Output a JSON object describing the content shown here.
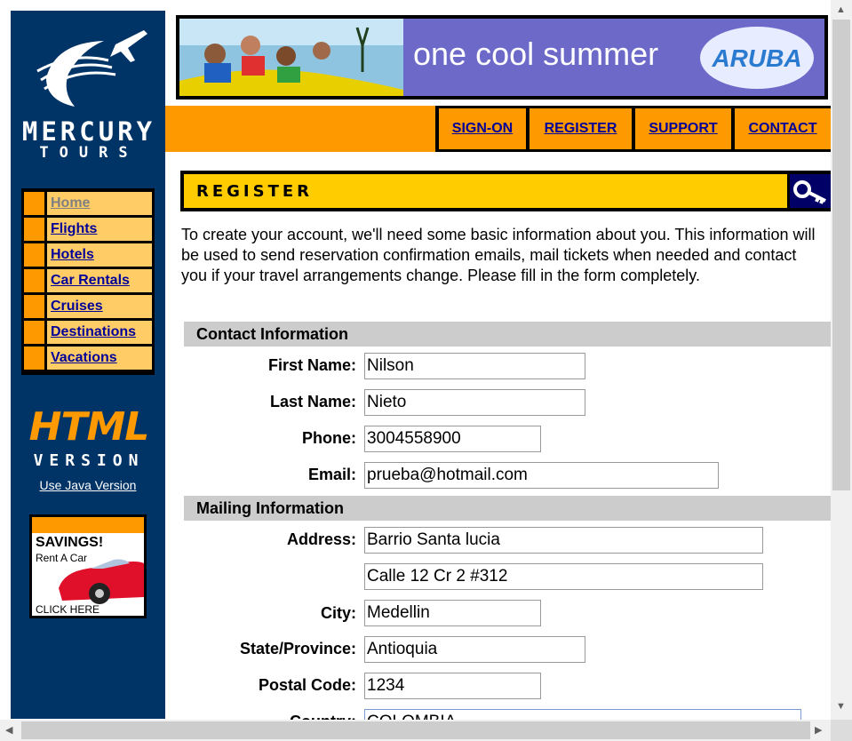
{
  "logo": {
    "line1": "MERCURY",
    "line2": "TOURS"
  },
  "nav": {
    "items": [
      {
        "label": "Home"
      },
      {
        "label": "Flights"
      },
      {
        "label": "Hotels"
      },
      {
        "label": "Car Rentals"
      },
      {
        "label": "Cruises"
      },
      {
        "label": "Destinations"
      },
      {
        "label": "Vacations"
      }
    ]
  },
  "html_version": {
    "big": "HTML",
    "sub": "VERSION",
    "link": "Use Java Version"
  },
  "ad": {
    "title": "SAVINGS!",
    "sub": "Rent A Car",
    "cta": "CLICK HERE"
  },
  "banner": {
    "text": "one cool summer",
    "brand": "ARUBA"
  },
  "menu": {
    "signon": "SIGN-ON",
    "register": "REGISTER",
    "support": "SUPPORT",
    "contact": "CONTACT"
  },
  "page_title": "REGISTER",
  "intro": "To create your account, we'll need some basic information about you. This information will be used to send reservation confirmation emails, mail tickets when needed and contact you if your travel arrangements change. Please fill in the form completely.",
  "contact": {
    "heading": "Contact Information",
    "first_name_label": "First Name:",
    "first_name": "Nilson",
    "last_name_label": "Last Name:",
    "last_name": "Nieto",
    "phone_label": "Phone:",
    "phone": "3004558900",
    "email_label": "Email:",
    "email": "prueba@hotmail.com"
  },
  "mailing": {
    "heading": "Mailing Information",
    "address_label": "Address:",
    "address1": "Barrio Santa lucia",
    "address2": "Calle 12 Cr 2 #312",
    "city_label": "City:",
    "city": "Medellin",
    "state_label": "State/Province:",
    "state": "Antioquia",
    "postal_label": "Postal Code:",
    "postal": "1234",
    "country_label": "Country:",
    "country": "COLOMBIA"
  },
  "colors": {
    "nav_bg": "#003366",
    "accent_orange": "#ff9900",
    "banner_blue": "#6c69c9",
    "link_blue": "#000099",
    "title_yellow": "#ffcc00"
  }
}
